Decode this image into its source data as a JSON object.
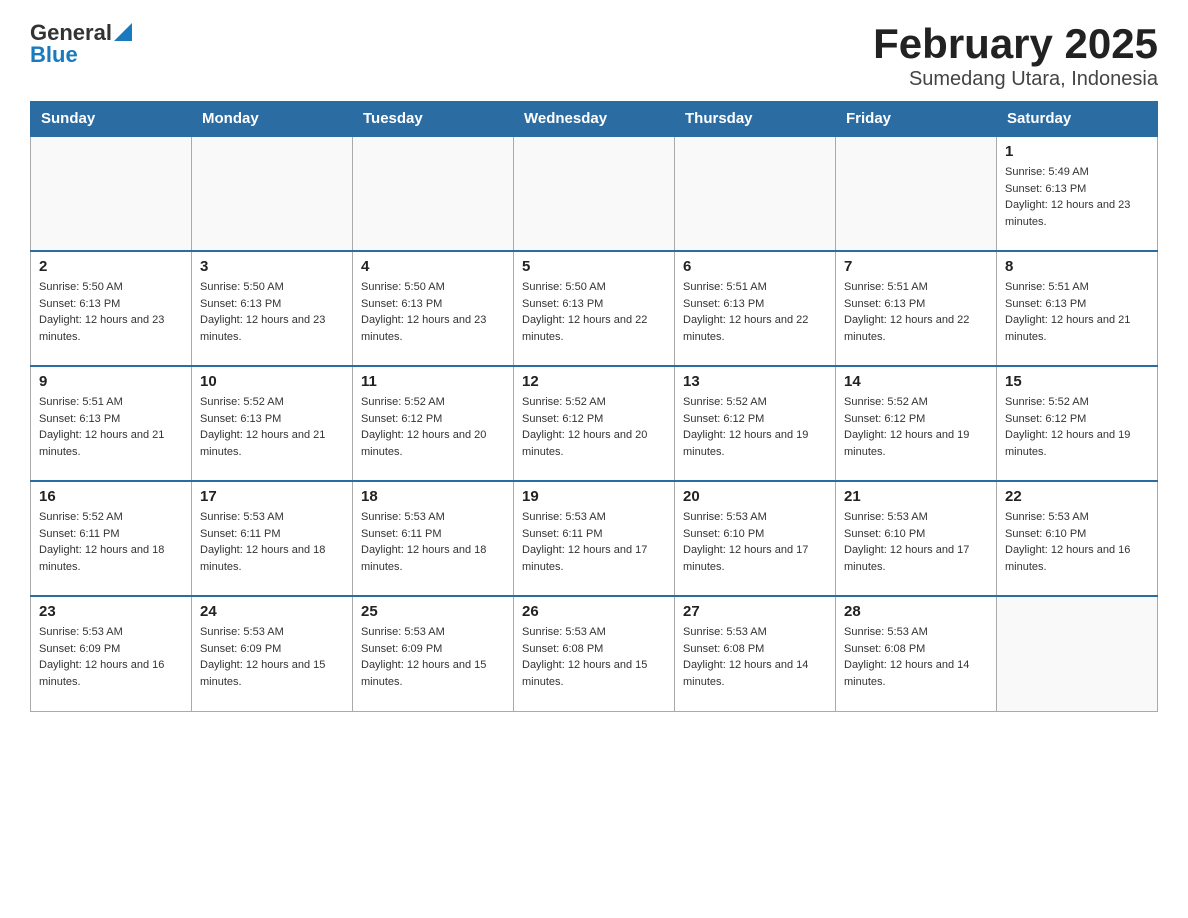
{
  "header": {
    "logo_general": "General",
    "logo_blue": "Blue",
    "title": "February 2025",
    "subtitle": "Sumedang Utara, Indonesia"
  },
  "days_of_week": [
    "Sunday",
    "Monday",
    "Tuesday",
    "Wednesday",
    "Thursday",
    "Friday",
    "Saturday"
  ],
  "weeks": [
    [
      {
        "day": "",
        "info": ""
      },
      {
        "day": "",
        "info": ""
      },
      {
        "day": "",
        "info": ""
      },
      {
        "day": "",
        "info": ""
      },
      {
        "day": "",
        "info": ""
      },
      {
        "day": "",
        "info": ""
      },
      {
        "day": "1",
        "info": "Sunrise: 5:49 AM\nSunset: 6:13 PM\nDaylight: 12 hours and 23 minutes."
      }
    ],
    [
      {
        "day": "2",
        "info": "Sunrise: 5:50 AM\nSunset: 6:13 PM\nDaylight: 12 hours and 23 minutes."
      },
      {
        "day": "3",
        "info": "Sunrise: 5:50 AM\nSunset: 6:13 PM\nDaylight: 12 hours and 23 minutes."
      },
      {
        "day": "4",
        "info": "Sunrise: 5:50 AM\nSunset: 6:13 PM\nDaylight: 12 hours and 23 minutes."
      },
      {
        "day": "5",
        "info": "Sunrise: 5:50 AM\nSunset: 6:13 PM\nDaylight: 12 hours and 22 minutes."
      },
      {
        "day": "6",
        "info": "Sunrise: 5:51 AM\nSunset: 6:13 PM\nDaylight: 12 hours and 22 minutes."
      },
      {
        "day": "7",
        "info": "Sunrise: 5:51 AM\nSunset: 6:13 PM\nDaylight: 12 hours and 22 minutes."
      },
      {
        "day": "8",
        "info": "Sunrise: 5:51 AM\nSunset: 6:13 PM\nDaylight: 12 hours and 21 minutes."
      }
    ],
    [
      {
        "day": "9",
        "info": "Sunrise: 5:51 AM\nSunset: 6:13 PM\nDaylight: 12 hours and 21 minutes."
      },
      {
        "day": "10",
        "info": "Sunrise: 5:52 AM\nSunset: 6:13 PM\nDaylight: 12 hours and 21 minutes."
      },
      {
        "day": "11",
        "info": "Sunrise: 5:52 AM\nSunset: 6:12 PM\nDaylight: 12 hours and 20 minutes."
      },
      {
        "day": "12",
        "info": "Sunrise: 5:52 AM\nSunset: 6:12 PM\nDaylight: 12 hours and 20 minutes."
      },
      {
        "day": "13",
        "info": "Sunrise: 5:52 AM\nSunset: 6:12 PM\nDaylight: 12 hours and 19 minutes."
      },
      {
        "day": "14",
        "info": "Sunrise: 5:52 AM\nSunset: 6:12 PM\nDaylight: 12 hours and 19 minutes."
      },
      {
        "day": "15",
        "info": "Sunrise: 5:52 AM\nSunset: 6:12 PM\nDaylight: 12 hours and 19 minutes."
      }
    ],
    [
      {
        "day": "16",
        "info": "Sunrise: 5:52 AM\nSunset: 6:11 PM\nDaylight: 12 hours and 18 minutes."
      },
      {
        "day": "17",
        "info": "Sunrise: 5:53 AM\nSunset: 6:11 PM\nDaylight: 12 hours and 18 minutes."
      },
      {
        "day": "18",
        "info": "Sunrise: 5:53 AM\nSunset: 6:11 PM\nDaylight: 12 hours and 18 minutes."
      },
      {
        "day": "19",
        "info": "Sunrise: 5:53 AM\nSunset: 6:11 PM\nDaylight: 12 hours and 17 minutes."
      },
      {
        "day": "20",
        "info": "Sunrise: 5:53 AM\nSunset: 6:10 PM\nDaylight: 12 hours and 17 minutes."
      },
      {
        "day": "21",
        "info": "Sunrise: 5:53 AM\nSunset: 6:10 PM\nDaylight: 12 hours and 17 minutes."
      },
      {
        "day": "22",
        "info": "Sunrise: 5:53 AM\nSunset: 6:10 PM\nDaylight: 12 hours and 16 minutes."
      }
    ],
    [
      {
        "day": "23",
        "info": "Sunrise: 5:53 AM\nSunset: 6:09 PM\nDaylight: 12 hours and 16 minutes."
      },
      {
        "day": "24",
        "info": "Sunrise: 5:53 AM\nSunset: 6:09 PM\nDaylight: 12 hours and 15 minutes."
      },
      {
        "day": "25",
        "info": "Sunrise: 5:53 AM\nSunset: 6:09 PM\nDaylight: 12 hours and 15 minutes."
      },
      {
        "day": "26",
        "info": "Sunrise: 5:53 AM\nSunset: 6:08 PM\nDaylight: 12 hours and 15 minutes."
      },
      {
        "day": "27",
        "info": "Sunrise: 5:53 AM\nSunset: 6:08 PM\nDaylight: 12 hours and 14 minutes."
      },
      {
        "day": "28",
        "info": "Sunrise: 5:53 AM\nSunset: 6:08 PM\nDaylight: 12 hours and 14 minutes."
      },
      {
        "day": "",
        "info": ""
      }
    ]
  ]
}
